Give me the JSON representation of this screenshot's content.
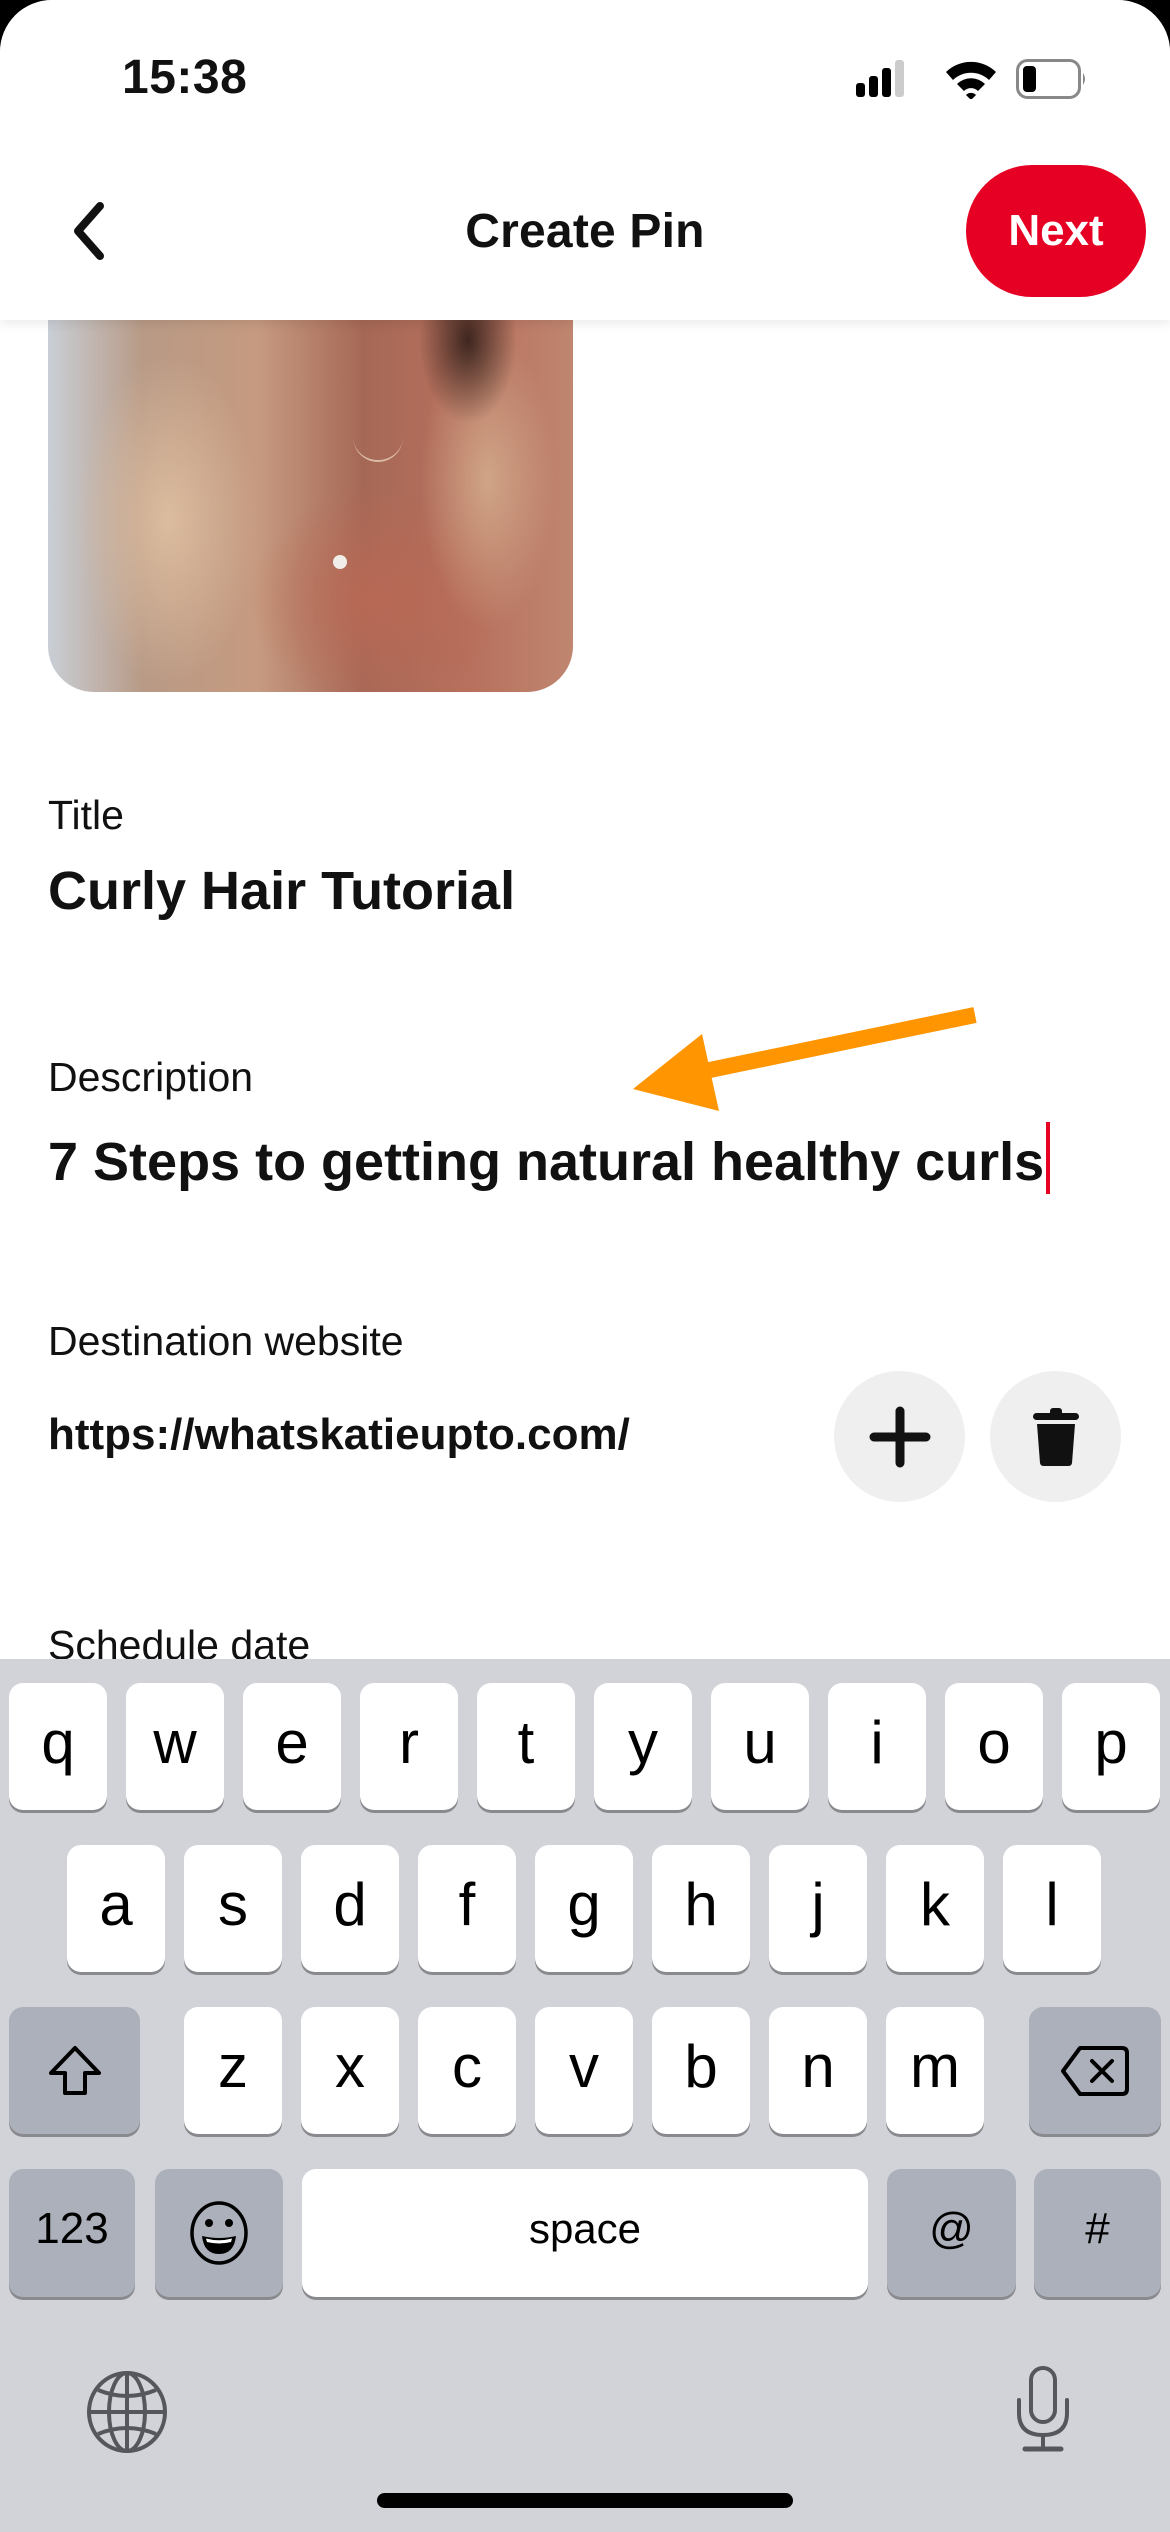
{
  "status_bar": {
    "time": "15:38",
    "signal_bars_active": 3,
    "signal_bars_total": 4,
    "battery_level_fraction": 0.25
  },
  "navbar": {
    "title": "Create Pin",
    "back_icon": "chevron-left-icon",
    "next_label": "Next",
    "accent_color": "#E60023"
  },
  "pin_image": {
    "description": "Pin image: person with long curly blonde hair wearing a rust-pink blouse"
  },
  "form": {
    "title": {
      "label": "Title",
      "value": "Curly Hair Tutorial"
    },
    "description": {
      "label": "Description",
      "value": "7 Steps to getting natural healthy curls"
    },
    "destination_website": {
      "label": "Destination website",
      "value": "https://whatskatieupto.com/",
      "add_icon": "plus-icon",
      "delete_icon": "trash-icon"
    },
    "schedule_date": {
      "label": "Schedule date"
    }
  },
  "annotation": {
    "type": "arrow",
    "color": "#FF9500",
    "points_to": "description"
  },
  "keyboard": {
    "rows": [
      [
        "q",
        "w",
        "e",
        "r",
        "t",
        "y",
        "u",
        "i",
        "o",
        "p"
      ],
      [
        "a",
        "s",
        "d",
        "f",
        "g",
        "h",
        "j",
        "k",
        "l"
      ],
      [
        "z",
        "x",
        "c",
        "v",
        "b",
        "n",
        "m"
      ]
    ],
    "shift_icon": "shift-icon",
    "backspace_icon": "backspace-icon",
    "numbers_label": "123",
    "emoji_icon": "emoji-icon",
    "space_label": "space",
    "at_label": "@",
    "hash_label": "#",
    "globe_icon": "globe-icon",
    "mic_icon": "microphone-icon"
  }
}
